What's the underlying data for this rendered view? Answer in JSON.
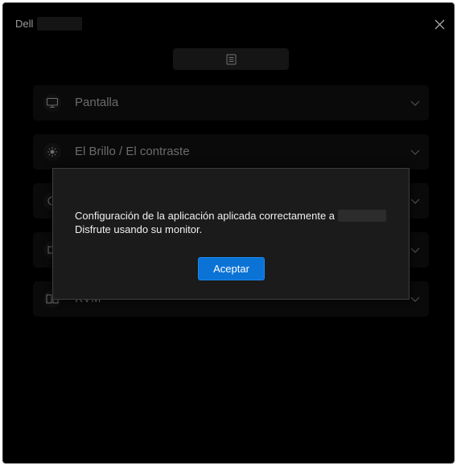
{
  "window": {
    "app_title": "Dell",
    "close_icon": "close-icon"
  },
  "toolbar": {
    "icon": "document-list-icon"
  },
  "sections": [
    {
      "label": "Pantalla",
      "icon": "monitor-icon"
    },
    {
      "label": "El Brillo / El contraste",
      "icon": "brightness-icon"
    },
    {
      "label": "",
      "icon": "circle-icon"
    },
    {
      "label": "",
      "icon": "input-icon"
    },
    {
      "label": "KVM",
      "icon": "kvm-icon"
    }
  ],
  "dialog": {
    "message_line1": "Configuración de la aplicación aplicada correctamente a",
    "message_line2": "Disfrute usando su monitor.",
    "accept_label": "Aceptar"
  },
  "colors": {
    "background": "#000000",
    "dialog_bg": "#1b1b1b",
    "accent": "#0b73d6"
  }
}
